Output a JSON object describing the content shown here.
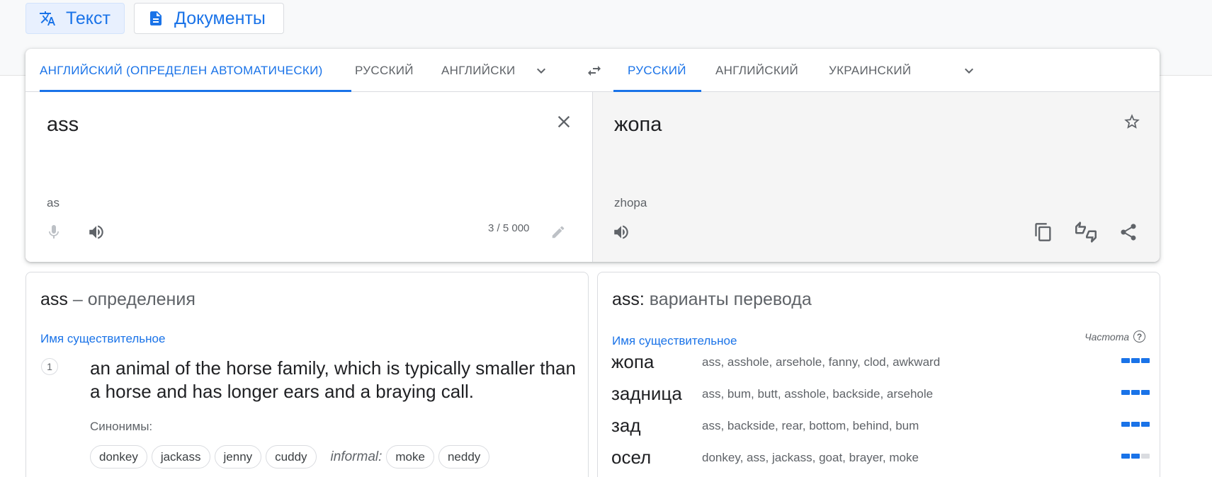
{
  "modes": {
    "text": "Текст",
    "documents": "Документы"
  },
  "source_langs": {
    "detected": "АНГЛИЙСКИЙ (ОПРЕДЕЛЕН АВТОМАТИЧЕСКИ)",
    "lang1": "РУССКИЙ",
    "lang2": "АНГЛИЙСКИ"
  },
  "target_langs": {
    "selected": "РУССКИЙ",
    "lang1": "АНГЛИЙСКИЙ",
    "lang2": "УКРАИНСКИЙ"
  },
  "source": {
    "text": "ass",
    "transliteration": "as",
    "char_count": "3 / 5 000"
  },
  "target": {
    "text": "жопа",
    "transliteration": "zhopa"
  },
  "definitions": {
    "word": "ass",
    "title_suffix": " – определения",
    "pos": "Имя существительное",
    "items": [
      {
        "num": "1",
        "text": "an animal of the horse family, which is typically smaller than a horse and has longer ears and a braying call.",
        "synonyms_label": "Синонимы:",
        "synonyms": [
          "donkey",
          "jackass",
          "jenny",
          "cuddy"
        ],
        "informal_label": "informal:",
        "informal_synonyms": [
          "moke",
          "neddy"
        ]
      }
    ]
  },
  "alternatives": {
    "word": "ass:",
    "title_suffix": " варианты перевода",
    "pos": "Имя существительное",
    "frequency_label": "Частота",
    "rows": [
      {
        "word": "жопа",
        "back": [
          "ass",
          "asshole",
          "arsehole",
          "fanny",
          "clod",
          "awkward"
        ],
        "frequency": 3
      },
      {
        "word": "задница",
        "back": [
          "ass",
          "bum",
          "butt",
          "asshole",
          "backside",
          "arsehole"
        ],
        "frequency": 3
      },
      {
        "word": "зад",
        "back": [
          "ass",
          "backside",
          "rear",
          "bottom",
          "behind",
          "bum"
        ],
        "frequency": 3
      },
      {
        "word": "осел",
        "back": [
          "donkey",
          "ass",
          "jackass",
          "goat",
          "brayer",
          "moke"
        ],
        "frequency": 2
      }
    ]
  },
  "colors": {
    "accent": "#1a73e8",
    "text": "#202124",
    "muted": "#5f6368",
    "target_bg": "#f5f5f5"
  }
}
